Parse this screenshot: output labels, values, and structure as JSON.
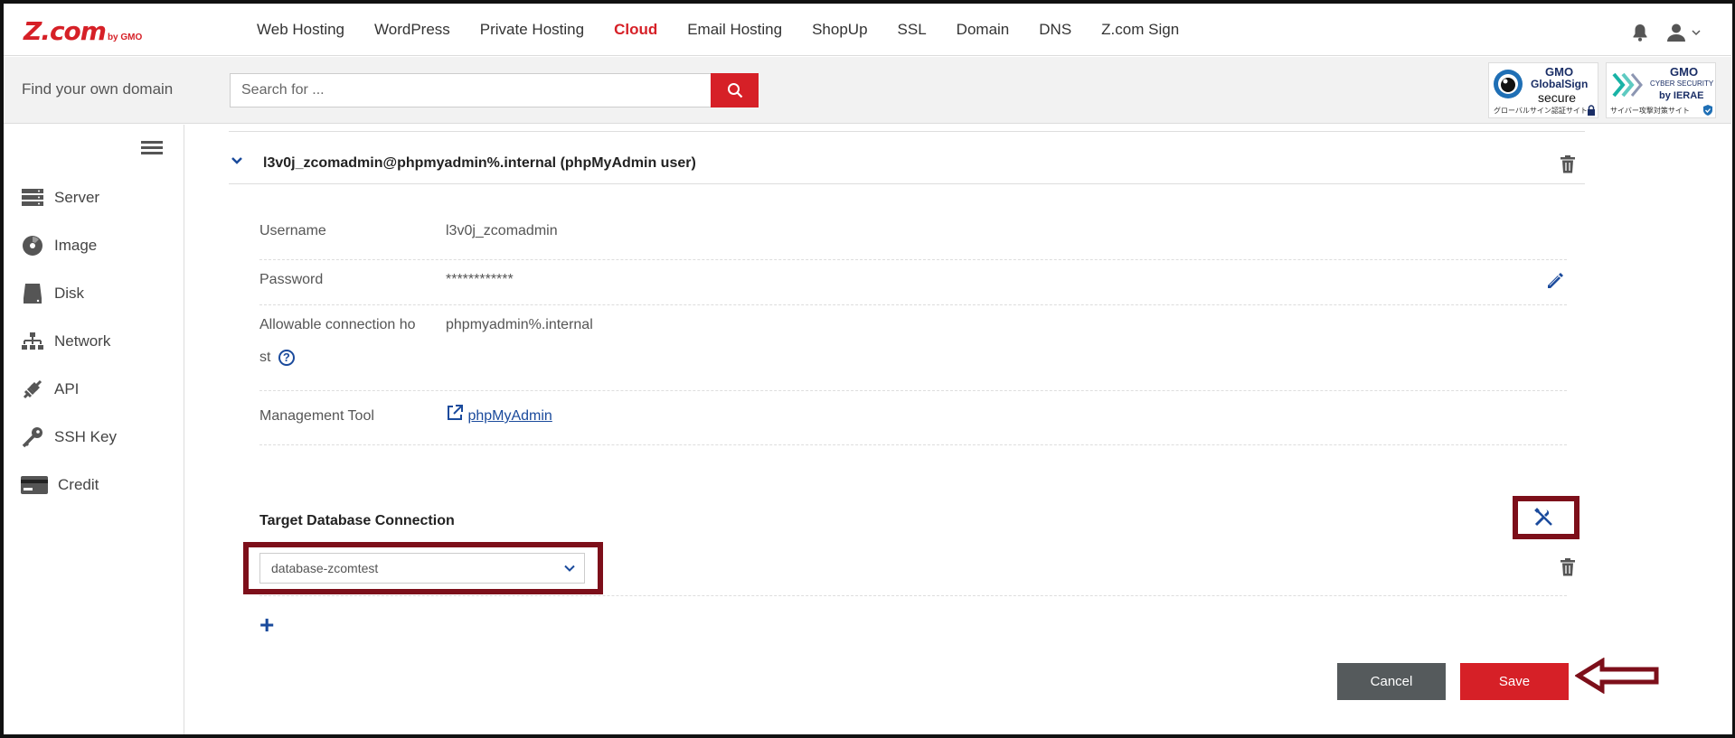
{
  "brand": {
    "logo": "Z.com",
    "logo_sub": "by GMO"
  },
  "nav": {
    "items": [
      "Web Hosting",
      "WordPress",
      "Private Hosting",
      "Cloud",
      "Email Hosting",
      "ShopUp",
      "SSL",
      "Domain",
      "DNS",
      "Z.com Sign"
    ],
    "active": "Cloud"
  },
  "search": {
    "label": "Find your own domain",
    "placeholder": "Search for ..."
  },
  "badges": {
    "globalsign": {
      "brand": "GMO",
      "line1": "GlobalSign",
      "line2": "secure",
      "footer": "グローバルサイン認証サイト"
    },
    "ierae": {
      "brand": "GMO",
      "line1": "CYBER SECURITY",
      "line2": "by IERAE",
      "footer": "サイバー攻撃対策サイト"
    }
  },
  "sidebar": {
    "items": [
      {
        "label": "Server",
        "icon": "server-icon"
      },
      {
        "label": "Image",
        "icon": "image-disc-icon"
      },
      {
        "label": "Disk",
        "icon": "disk-icon"
      },
      {
        "label": "Network",
        "icon": "network-icon"
      },
      {
        "label": "API",
        "icon": "api-plug-icon"
      },
      {
        "label": "SSH Key",
        "icon": "key-icon"
      },
      {
        "label": "Credit",
        "icon": "credit-card-icon"
      }
    ]
  },
  "user": {
    "title": "l3v0j_zcomadmin@phpmyadmin%.internal (phpMyAdmin user)",
    "fields": {
      "username_label": "Username",
      "username_value": "l3v0j_zcomadmin",
      "password_label": "Password",
      "password_value": "************",
      "host_label_1": "Allowable connection ho",
      "host_label_2": "st",
      "host_value": "phpmyadmin%.internal",
      "tool_label": "Management Tool",
      "tool_value": "phpMyAdmin"
    }
  },
  "target_db": {
    "title": "Target Database Connection",
    "selected": "database-zcomtest"
  },
  "buttons": {
    "cancel": "Cancel",
    "save": "Save"
  },
  "colors": {
    "brand_red": "#d62027",
    "accent_blue": "#1a4a9c",
    "highlight": "#7d0f1a",
    "cancel_gray": "#555a5c"
  }
}
